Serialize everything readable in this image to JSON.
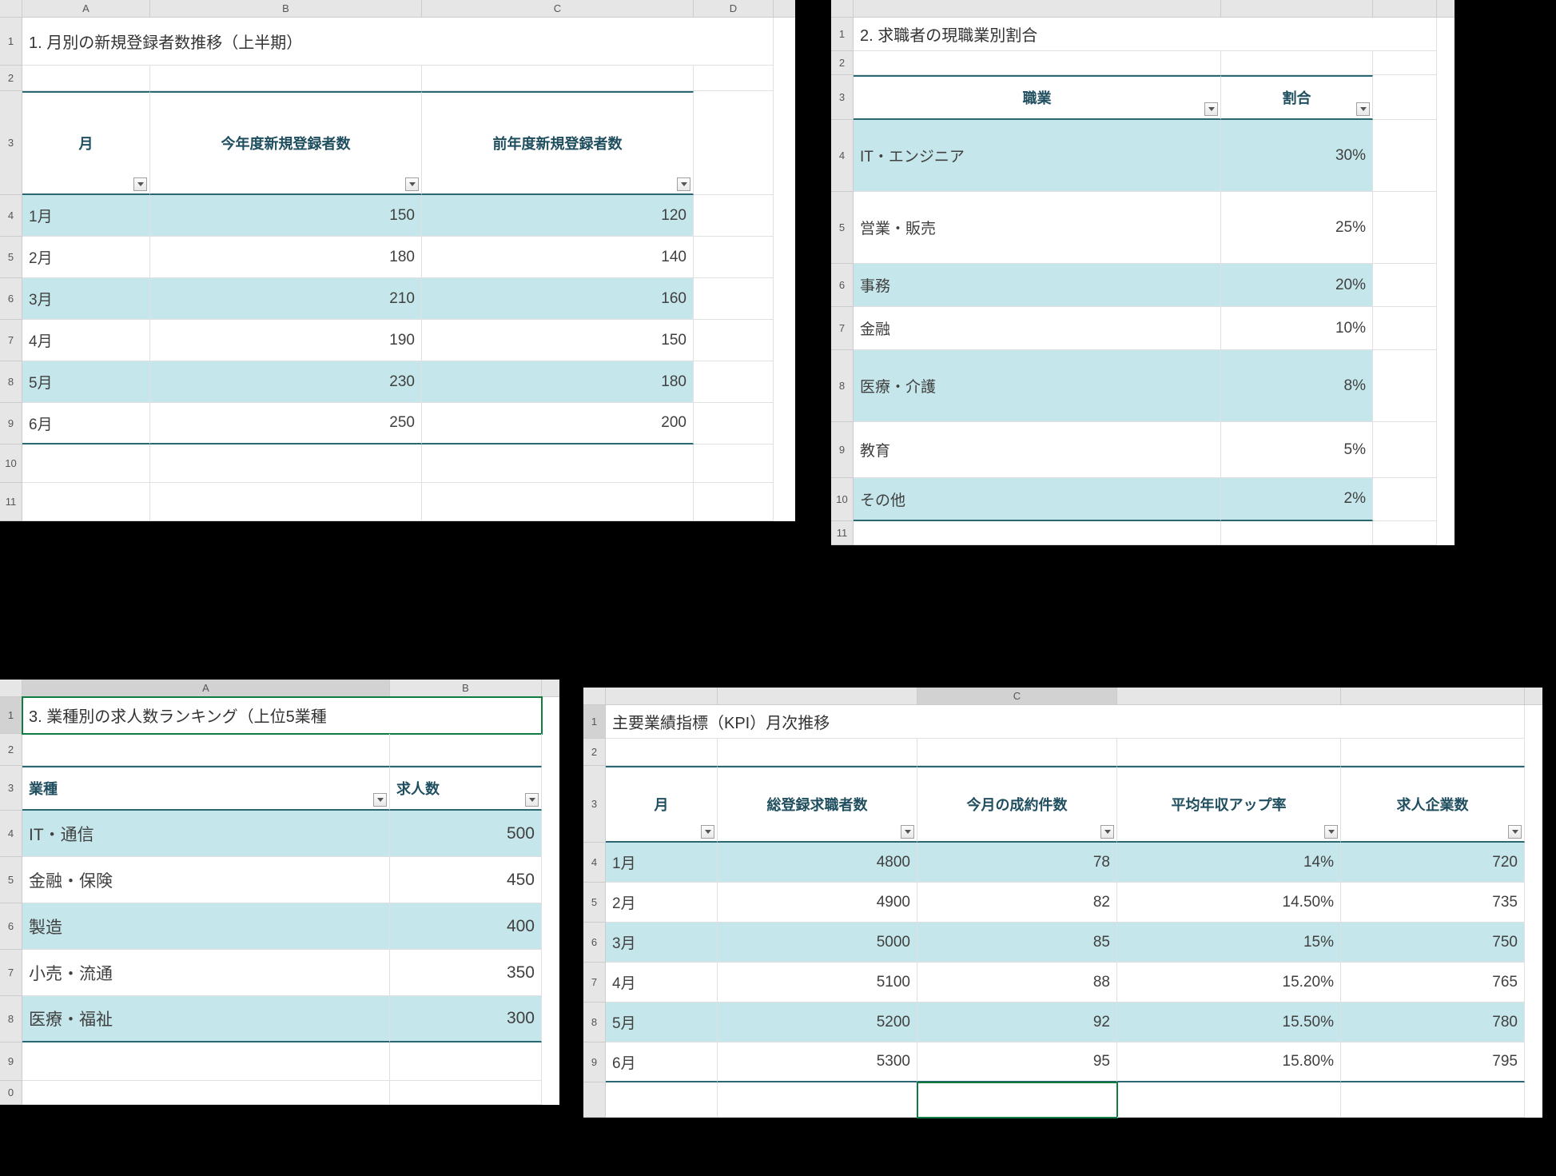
{
  "panel1": {
    "title": "1. 月別の新規登録者数推移（上半期）",
    "cols": [
      "A",
      "B",
      "C",
      "D"
    ],
    "headers": {
      "c1": "月",
      "c2": "今年度新規登録者数",
      "c3": "前年度新規登録者数"
    },
    "rows": [
      {
        "m": "1月",
        "a": "150",
        "b": "120"
      },
      {
        "m": "2月",
        "a": "180",
        "b": "140"
      },
      {
        "m": "3月",
        "a": "210",
        "b": "160"
      },
      {
        "m": "4月",
        "a": "190",
        "b": "150"
      },
      {
        "m": "5月",
        "a": "230",
        "b": "180"
      },
      {
        "m": "6月",
        "a": "250",
        "b": "200"
      }
    ]
  },
  "panel2": {
    "title": "2. 求職者の現職業別割合",
    "headers": {
      "c1": "職業",
      "c2": "割合"
    },
    "rows": [
      {
        "k": "IT・エンジニア",
        "v": "30%"
      },
      {
        "k": "営業・販売",
        "v": "25%"
      },
      {
        "k": "事務",
        "v": "20%"
      },
      {
        "k": "金融",
        "v": "10%"
      },
      {
        "k": "医療・介護",
        "v": "8%"
      },
      {
        "k": "教育",
        "v": "5%"
      },
      {
        "k": "その他",
        "v": "2%"
      }
    ]
  },
  "panel3": {
    "title": "3. 業種別の求人数ランキング（上位5業種",
    "headers": {
      "c1": "業種",
      "c2": "求人数"
    },
    "rows": [
      {
        "k": "IT・通信",
        "v": "500"
      },
      {
        "k": "金融・保険",
        "v": "450"
      },
      {
        "k": "製造",
        "v": "400"
      },
      {
        "k": "小売・流通",
        "v": "350"
      },
      {
        "k": "医療・福祉",
        "v": "300"
      }
    ]
  },
  "panel4": {
    "title": "主要業績指標（KPI）月次推移",
    "headers": {
      "c1": "月",
      "c2": "総登録求職者数",
      "c3": "今月の成約件数",
      "c4": "平均年収アップ率",
      "c5": "求人企業数"
    },
    "rows": [
      {
        "m": "1月",
        "a": "4800",
        "b": "78",
        "c": "14%",
        "d": "720"
      },
      {
        "m": "2月",
        "a": "4900",
        "b": "82",
        "c": "14.50%",
        "d": "735"
      },
      {
        "m": "3月",
        "a": "5000",
        "b": "85",
        "c": "15%",
        "d": "750"
      },
      {
        "m": "4月",
        "a": "5100",
        "b": "88",
        "c": "15.20%",
        "d": "765"
      },
      {
        "m": "5月",
        "a": "5200",
        "b": "92",
        "c": "15.50%",
        "d": "780"
      },
      {
        "m": "6月",
        "a": "5300",
        "b": "95",
        "c": "15.80%",
        "d": "795"
      }
    ]
  },
  "chart_data": [
    {
      "type": "table",
      "title": "月別の新規登録者数推移（上半期）",
      "categories": [
        "1月",
        "2月",
        "3月",
        "4月",
        "5月",
        "6月"
      ],
      "series": [
        {
          "name": "今年度新規登録者数",
          "values": [
            150,
            180,
            210,
            190,
            230,
            250
          ]
        },
        {
          "name": "前年度新規登録者数",
          "values": [
            120,
            140,
            160,
            150,
            180,
            200
          ]
        }
      ]
    },
    {
      "type": "table",
      "title": "求職者の現職業別割合",
      "categories": [
        "IT・エンジニア",
        "営業・販売",
        "事務",
        "金融",
        "医療・介護",
        "教育",
        "その他"
      ],
      "values": [
        30,
        25,
        20,
        10,
        8,
        5,
        2
      ],
      "unit": "%"
    },
    {
      "type": "table",
      "title": "業種別の求人数ランキング（上位5業種）",
      "categories": [
        "IT・通信",
        "金融・保険",
        "製造",
        "小売・流通",
        "医療・福祉"
      ],
      "values": [
        500,
        450,
        400,
        350,
        300
      ]
    },
    {
      "type": "table",
      "title": "主要業績指標（KPI）月次推移",
      "categories": [
        "1月",
        "2月",
        "3月",
        "4月",
        "5月",
        "6月"
      ],
      "series": [
        {
          "name": "総登録求職者数",
          "values": [
            4800,
            4900,
            5000,
            5100,
            5200,
            5300
          ]
        },
        {
          "name": "今月の成約件数",
          "values": [
            78,
            82,
            85,
            88,
            92,
            95
          ]
        },
        {
          "name": "平均年収アップ率",
          "values": [
            14,
            14.5,
            15,
            15.2,
            15.5,
            15.8
          ],
          "unit": "%"
        },
        {
          "name": "求人企業数",
          "values": [
            720,
            735,
            750,
            765,
            780,
            795
          ]
        }
      ]
    }
  ]
}
